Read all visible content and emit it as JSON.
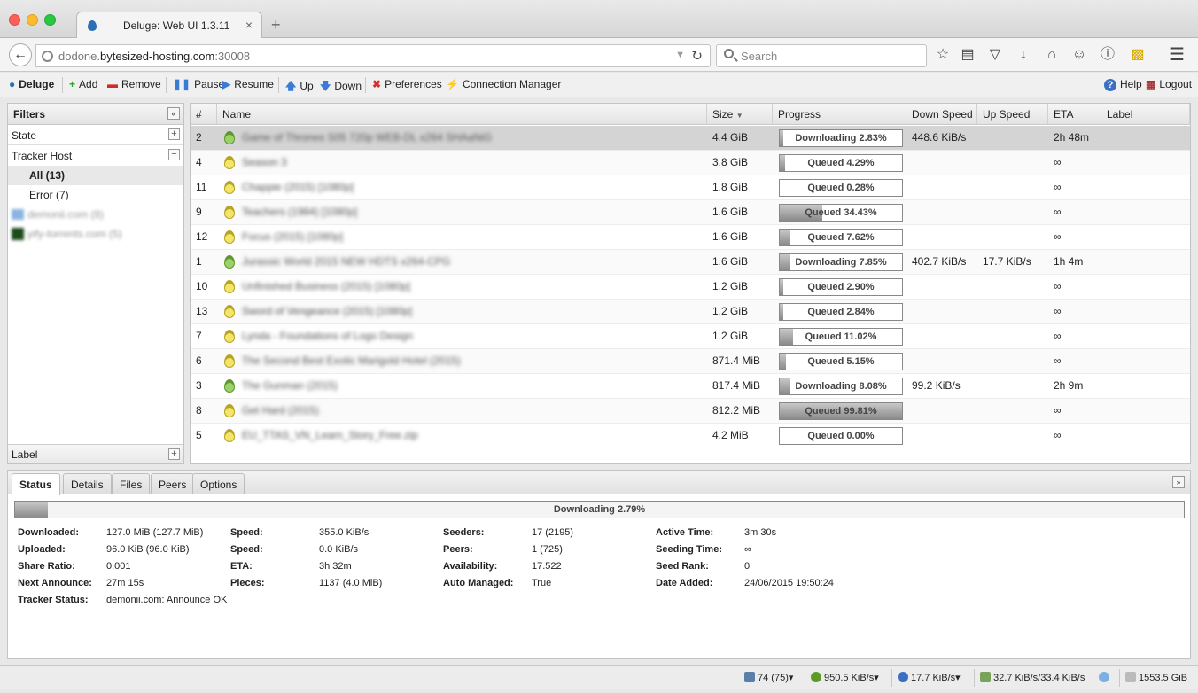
{
  "browser": {
    "tab_title": "Deluge: Web UI 1.3.11",
    "tab_close": "×",
    "new_tab": "+",
    "url_prefix": "dodone.",
    "url_host": "bytesized-hosting.com",
    "url_port": ":30008",
    "search_placeholder": "Search"
  },
  "toolbar": {
    "deluge": "Deluge",
    "add": "Add",
    "remove": "Remove",
    "pause": "Pause",
    "resume": "Resume",
    "up": "Up",
    "down": "Down",
    "preferences": "Preferences",
    "connection_manager": "Connection Manager",
    "help": "Help",
    "logout": "Logout"
  },
  "filters": {
    "title": "Filters",
    "state": "State",
    "tracker_host": "Tracker Host",
    "items": [
      "All (13)",
      "Error (7)"
    ],
    "trackers": [
      "demonii.com (8)",
      "yify-torrents.com (5)"
    ],
    "label": "Label"
  },
  "grid": {
    "headers": {
      "num": "#",
      "name": "Name",
      "size": "Size",
      "progress": "Progress",
      "down": "Down Speed",
      "up": "Up Speed",
      "eta": "ETA",
      "label": "Label"
    },
    "rows": [
      {
        "num": "2",
        "name": "Game of Thrones S05 720p WEB-DL x264 SHAaNiG",
        "size": "4.4 GiB",
        "state": "dl",
        "progress": 2.83,
        "ptext": "Downloading 2.83%",
        "down": "448.6 KiB/s",
        "up": "",
        "eta": "2h 48m"
      },
      {
        "num": "4",
        "name": "Season 3",
        "size": "3.8 GiB",
        "state": "q",
        "progress": 4.29,
        "ptext": "Queued 4.29%",
        "down": "",
        "up": "",
        "eta": "∞"
      },
      {
        "num": "11",
        "name": "Chappie (2015) [1080p]",
        "size": "1.8 GiB",
        "state": "q",
        "progress": 0.28,
        "ptext": "Queued 0.28%",
        "down": "",
        "up": "",
        "eta": "∞"
      },
      {
        "num": "9",
        "name": "Teachers (1984) [1080p]",
        "size": "1.6 GiB",
        "state": "q",
        "progress": 34.43,
        "ptext": "Queued 34.43%",
        "down": "",
        "up": "",
        "eta": "∞"
      },
      {
        "num": "12",
        "name": "Focus (2015) [1080p]",
        "size": "1.6 GiB",
        "state": "q",
        "progress": 7.62,
        "ptext": "Queued 7.62%",
        "down": "",
        "up": "",
        "eta": "∞"
      },
      {
        "num": "1",
        "name": "Jurassic World 2015 NEW HDTS x264-CPG",
        "size": "1.6 GiB",
        "state": "dl",
        "progress": 7.85,
        "ptext": "Downloading 7.85%",
        "down": "402.7 KiB/s",
        "up": "17.7 KiB/s",
        "eta": "1h 4m"
      },
      {
        "num": "10",
        "name": "Unfinished Business (2015) [1080p]",
        "size": "1.2 GiB",
        "state": "q",
        "progress": 2.9,
        "ptext": "Queued 2.90%",
        "down": "",
        "up": "",
        "eta": "∞"
      },
      {
        "num": "13",
        "name": "Sword of Vengeance (2015) [1080p]",
        "size": "1.2 GiB",
        "state": "q",
        "progress": 2.84,
        "ptext": "Queued 2.84%",
        "down": "",
        "up": "",
        "eta": "∞"
      },
      {
        "num": "7",
        "name": "Lynda - Foundations of Logo Design",
        "size": "1.2 GiB",
        "state": "q",
        "progress": 11.02,
        "ptext": "Queued 11.02%",
        "down": "",
        "up": "",
        "eta": "∞"
      },
      {
        "num": "6",
        "name": "The Second Best Exotic Marigold Hotel (2015)",
        "size": "871.4 MiB",
        "state": "q",
        "progress": 5.15,
        "ptext": "Queued 5.15%",
        "down": "",
        "up": "",
        "eta": "∞"
      },
      {
        "num": "3",
        "name": "The Gunman (2015)",
        "size": "817.4 MiB",
        "state": "dl",
        "progress": 8.08,
        "ptext": "Downloading 8.08%",
        "down": "99.2 KiB/s",
        "up": "",
        "eta": "2h 9m"
      },
      {
        "num": "8",
        "name": "Get Hard (2015)",
        "size": "812.2 MiB",
        "state": "q",
        "progress": 99.81,
        "ptext": "Queued 99.81%",
        "down": "",
        "up": "",
        "eta": "∞"
      },
      {
        "num": "5",
        "name": "EU_TTAS_VN_Learn_Story_Free.zip",
        "size": "4.2 MiB",
        "state": "q",
        "progress": 0.0,
        "ptext": "Queued 0.00%",
        "down": "",
        "up": "",
        "eta": "∞"
      }
    ]
  },
  "details": {
    "tabs": [
      "Status",
      "Details",
      "Files",
      "Peers",
      "Options"
    ],
    "progress": 2.79,
    "progress_text": "Downloading 2.79%",
    "stats": {
      "downloaded_l": "Downloaded:",
      "downloaded_v": "127.0 MiB (127.7 MiB)",
      "uploaded_l": "Uploaded:",
      "uploaded_v": "96.0 KiB (96.0 KiB)",
      "ratio_l": "Share Ratio:",
      "ratio_v": "0.001",
      "announce_l": "Next Announce:",
      "announce_v": "27m 15s",
      "tracker_l": "Tracker Status:",
      "tracker_v": "demonii.com: Announce OK",
      "speed1_l": "Speed:",
      "speed1_v": "355.0 KiB/s",
      "speed2_l": "Speed:",
      "speed2_v": "0.0 KiB/s",
      "eta_l": "ETA:",
      "eta_v": "3h 32m",
      "pieces_l": "Pieces:",
      "pieces_v": "1137 (4.0 MiB)",
      "seeders_l": "Seeders:",
      "seeders_v": "17 (2195)",
      "peers_l": "Peers:",
      "peers_v": "1 (725)",
      "avail_l": "Availability:",
      "avail_v": "17.522",
      "auto_l": "Auto Managed:",
      "auto_v": "True",
      "active_l": "Active Time:",
      "active_v": "3m 30s",
      "seeding_l": "Seeding Time:",
      "seeding_v": "∞",
      "rank_l": "Seed Rank:",
      "rank_v": "0",
      "added_l": "Date Added:",
      "added_v": "24/06/2015 19:50:24"
    }
  },
  "statusbar": {
    "connections": "74 (75)",
    "down": "950.5 KiB/s",
    "up": "17.7 KiB/s",
    "protocol": "32.7 KiB/s/33.4 KiB/s",
    "free_space": "1553.5 GiB"
  },
  "colors": {
    "downloading": "#5e9a2a",
    "queued": "#b7a423",
    "accent": "#2d6fb5"
  }
}
